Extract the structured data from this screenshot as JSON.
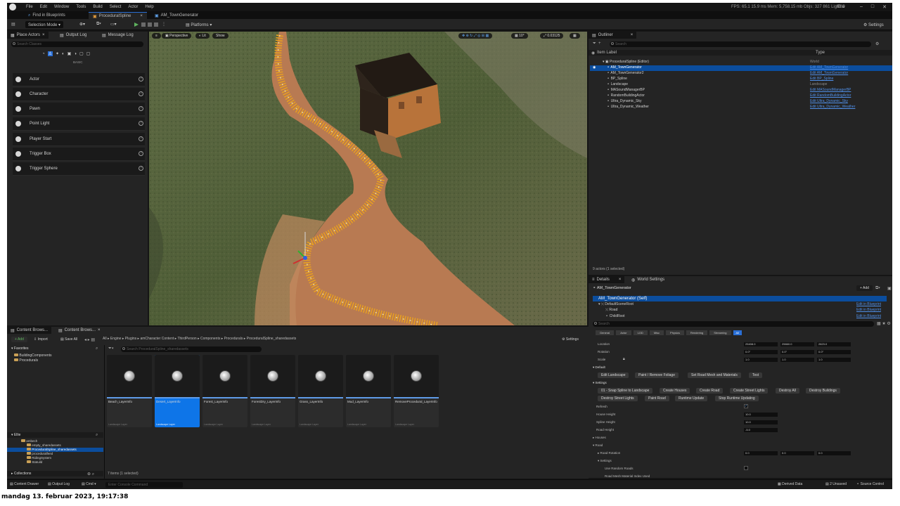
{
  "menubar": {
    "items": [
      "File",
      "Edit",
      "Window",
      "Tools",
      "Build",
      "Select",
      "Actor",
      "Help"
    ],
    "stats": "FPS: 65.1  15.9 ms  Mem: 5,758.15 mb  Objs: 327 861  Light: 0",
    "workspace": "Ella"
  },
  "tabs": [
    "Find in Blueprints",
    "ProceduralSpline",
    "AM_TownGenerator"
  ],
  "toolbar": {
    "mode": "Selection Mode",
    "platforms": "Platforms",
    "settings": "Settings"
  },
  "place_actors": {
    "tab": "Place Actors",
    "tab2": "Output Log",
    "tab3": "Message Log",
    "search": "Search Classes",
    "section": "BASIC",
    "items": [
      "Actor",
      "Character",
      "Pawn",
      "Point Light",
      "Player Start",
      "Trigger Box",
      "Trigger Sphere"
    ]
  },
  "viewport": {
    "perspective": "Perspective",
    "lit": "Lit",
    "show": "Show",
    "grid": "10°",
    "scale": "0.03125"
  },
  "outliner": {
    "tab": "Outliner",
    "search": "Search",
    "col_label": "Item Label",
    "col_type": "Type",
    "rows": [
      {
        "label": "ProceduralSpline (Editor)",
        "type": "World"
      },
      {
        "label": "AM_TownGenerator",
        "type": "Edit AM_TownGenerator"
      },
      {
        "label": "AM_TownGenerator2",
        "type": "Edit AM_TownGenerator"
      },
      {
        "label": "BP_Spline",
        "type": "Edit BP_Spline"
      },
      {
        "label": "Landscape",
        "type": "Landscape"
      },
      {
        "label": "MASoundManagerBP",
        "type": "Edit MASoundManagerBP"
      },
      {
        "label": "RandomBuildingActor",
        "type": "Edit RandomBuildingActor"
      },
      {
        "label": "Ultra_Dynamic_Sky",
        "type": "Edit Ultra_Dynamic_Sky"
      },
      {
        "label": "Ultra_Dynamic_Weather",
        "type": "Edit Ultra_Dynamic_Weather"
      }
    ],
    "footer": "9 actors (1 selected)"
  },
  "details": {
    "tab": "Details",
    "tab2": "World Settings",
    "actor": "AM_TownGenerator",
    "add": "+ Add",
    "self": "AM_TownGenerator (Self)",
    "components": [
      "DefaultSceneRoot",
      "Road",
      "ChildRoot"
    ],
    "edit_bp": "Edit in Blueprint",
    "search": "Search",
    "filters": [
      "General",
      "Actor",
      "LOD",
      "Misc",
      "Physics",
      "Rendering",
      "Streaming",
      "All"
    ],
    "transform": [
      {
        "label": "Location",
        "v": [
          "25408.0",
          "25660.0",
          "2823.0"
        ]
      },
      {
        "label": "Rotation",
        "v": [
          "0.0°",
          "0.0°",
          "0.0°"
        ]
      },
      {
        "label": "Scale",
        "v": [
          "1.0",
          "1.0",
          "1.0"
        ]
      }
    ],
    "default": "Default",
    "edit_landscape": "Edit Landscape",
    "paint_remove": "Paint / Remove Foliage",
    "set_road": "Set Road Mesh and Materials",
    "test": "Test",
    "settings": "Settings",
    "buttons1": [
      "01 - Snap Spline to Landscape",
      "Create Houses",
      "Create Road",
      "Create Street Lights",
      "Destroy All",
      "Destroy Buildings"
    ],
    "buttons2": [
      "Destroy Street Lights",
      "Paint Road",
      "Runtime Update",
      "Stop Runtime Updating"
    ],
    "props": [
      {
        "label": "Refresh",
        "v": ""
      },
      {
        "label": "House Height",
        "v": "10.0"
      },
      {
        "label": "Spline Height",
        "v": "10.0"
      },
      {
        "label": "Road Height",
        "v": "-5.0"
      }
    ],
    "houses": "Houses",
    "road": "Road",
    "road_rotation": "Road Rotation",
    "road_rot_v": [
      "0.0",
      "0.0",
      "0.0"
    ],
    "settings2": "Settings",
    "use_random": "Use Random Roads",
    "road_mesh": "Road Mesh Material Index Used"
  },
  "content": {
    "tab": "Content Brows...",
    "tab2": "Content Brows...",
    "add": "+ Add",
    "import": "Import",
    "save_all": "Save All",
    "settings": "Settings",
    "crumbs": [
      "All",
      "Engine",
      "Plugins",
      "amCharacter Content",
      "ThirdPerson",
      "Components",
      "Procedurals",
      "ProceduralSpline_sharedassets"
    ],
    "search": "Search ProceduralSpline_sharedassets",
    "favorites": "Favorites",
    "fav_items": [
      "BuildingComponents",
      "Procedurals"
    ],
    "tree_title": "Ellie",
    "tree": [
      "ambech",
      "empty_sharedassets",
      "ProceduralSpline_sharedassets",
      "proceduralfeed",
      "RidingSystem",
      "Statuild",
      "Stardustech"
    ],
    "collections": "Collections",
    "assets": [
      {
        "name": "Beach_LayerInfo",
        "type": "Landscape Layer"
      },
      {
        "name": "Desert_LayerInfo",
        "type": "Landscape Layer"
      },
      {
        "name": "Forest_LayerInfo",
        "type": "Landscape Layer"
      },
      {
        "name": "ForestDry_LayerInfo",
        "type": "Landscape Layer"
      },
      {
        "name": "Grass_LayerInfo",
        "type": "Landscape Layer"
      },
      {
        "name": "Mud_LayerInfo",
        "type": "Landscape Layer"
      },
      {
        "name": "RemoveProcedural_LayerInfo",
        "type": "Landscape Layer"
      }
    ],
    "count": "7 items (1 selected)"
  },
  "statusbar": {
    "items": [
      "Content Drawer",
      "Output Log",
      "Cmd"
    ],
    "console": "Enter Console Command",
    "derived": "Derived Data",
    "unsaved": "2 Unsaved",
    "source": "Source Control"
  },
  "caption": "mandag 13. februar 2023, 19:17:38"
}
